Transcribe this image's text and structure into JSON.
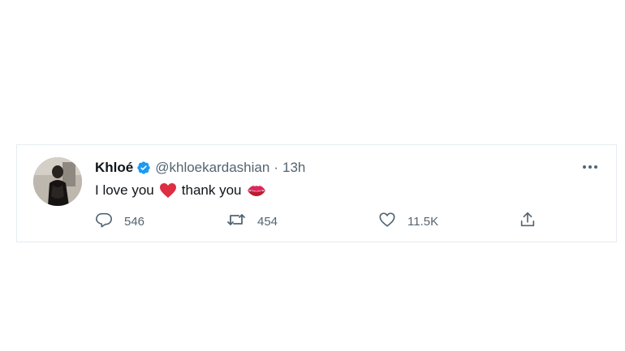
{
  "tweet": {
    "author_name": "Khloé",
    "handle": "@khloekardashian",
    "separator": "·",
    "time": "13h",
    "text_part1": "I love you",
    "text_part2": "thank you",
    "emoji_1": "red-heart-emoji",
    "emoji_2": "kiss-mark-emoji",
    "reply_count": "546",
    "retweet_count": "454",
    "like_count": "11.5K"
  },
  "colors": {
    "verified": "#1d9bf0",
    "secondary_text": "#536471",
    "primary_text": "#0f1419",
    "heart": "#e0245e",
    "border": "#e6ecf0"
  }
}
